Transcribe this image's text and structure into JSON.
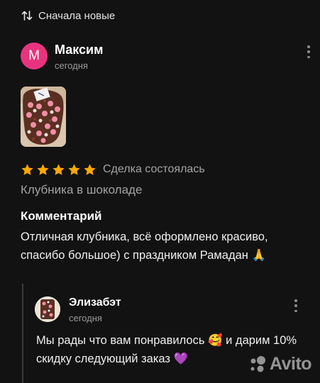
{
  "sort": {
    "label": "Сначала новые",
    "icon": "sort-arrows-icon"
  },
  "review": {
    "avatar_letter": "М",
    "avatar_color": "#e8347e",
    "author": "Максим",
    "date": "сегодня",
    "rating": 5,
    "max_rating": 5,
    "star_color": "#ffa800",
    "deal_status": "Сделка состоялась",
    "product": "Клубника в шоколаде",
    "comment_heading": "Комментарий",
    "comment": "Отличная клубника, всё оформлено красиво, спасибо большое) с праздником Рамадан 🙏"
  },
  "reply": {
    "author": "Элизабэт",
    "date": "сегодня",
    "text": "Мы рады что вам понравилось 🥰 и дарим 10% скидку следующий заказ 💜"
  },
  "watermark": {
    "text": "Avito"
  }
}
